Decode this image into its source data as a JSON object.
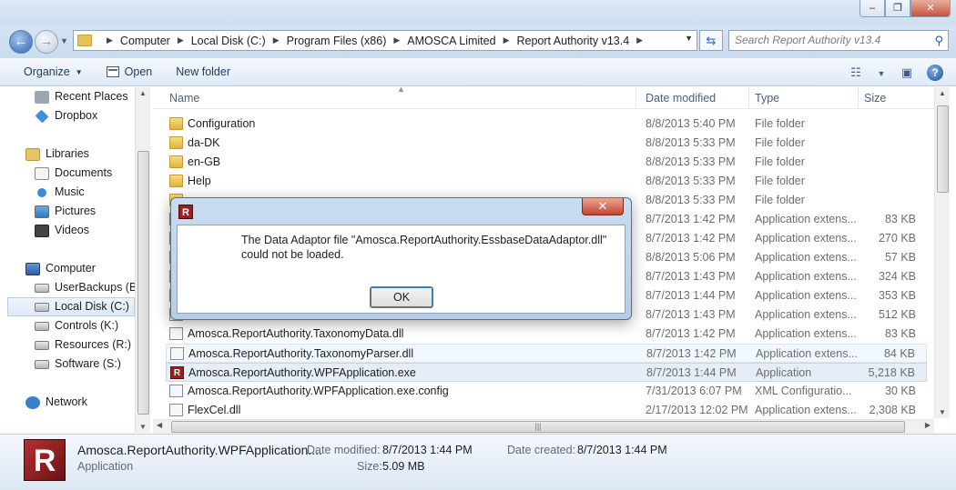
{
  "window": {
    "min": "–",
    "max": "❐",
    "close": "✕"
  },
  "address": {
    "crumbs": [
      "Computer",
      "Local Disk (C:)",
      "Program Files (x86)",
      "AMOSCA Limited",
      "Report Authority v13.4"
    ],
    "sep": "▶"
  },
  "search": {
    "placeholder": "Search Report Authority v13.4"
  },
  "toolbar": {
    "organize": "Organize",
    "open": "Open",
    "new_folder": "New folder"
  },
  "nav": {
    "recent": "Recent Places",
    "dropbox": "Dropbox",
    "libraries": "Libraries",
    "documents": "Documents",
    "music": "Music",
    "pictures": "Pictures",
    "videos": "Videos",
    "computer": "Computer",
    "drive_b": "UserBackups (B:)",
    "drive_c": "Local Disk (C:)",
    "drive_k": "Controls (K:)",
    "drive_r": "Resources (R:)",
    "drive_s": "Software (S:)",
    "network": "Network"
  },
  "columns": {
    "name": "Name",
    "date": "Date modified",
    "type": "Type",
    "size": "Size"
  },
  "files": [
    {
      "name": "Configuration",
      "date": "8/8/2013 5:40 PM",
      "type": "File folder",
      "size": "",
      "icon": "folder"
    },
    {
      "name": "da-DK",
      "date": "8/8/2013 5:33 PM",
      "type": "File folder",
      "size": "",
      "icon": "folder"
    },
    {
      "name": "en-GB",
      "date": "8/8/2013 5:33 PM",
      "type": "File folder",
      "size": "",
      "icon": "folder"
    },
    {
      "name": "Help",
      "date": "8/8/2013 5:33 PM",
      "type": "File folder",
      "size": "",
      "icon": "folder"
    },
    {
      "name": "",
      "date": "8/8/2013 5:33 PM",
      "type": "File folder",
      "size": "",
      "icon": "folder"
    },
    {
      "name": "",
      "date": "8/7/2013 1:42 PM",
      "type": "Application extens...",
      "size": "83 KB",
      "icon": "dll"
    },
    {
      "name": "",
      "date": "8/7/2013 1:42 PM",
      "type": "Application extens...",
      "size": "270 KB",
      "icon": "dll"
    },
    {
      "name": "",
      "date": "8/8/2013 5:06 PM",
      "type": "Application extens...",
      "size": "57 KB",
      "icon": "dll"
    },
    {
      "name": "",
      "date": "8/7/2013 1:43 PM",
      "type": "Application extens...",
      "size": "324 KB",
      "icon": "dll"
    },
    {
      "name": "",
      "date": "8/7/2013 1:44 PM",
      "type": "Application extens...",
      "size": "353 KB",
      "icon": "dll"
    },
    {
      "name": "",
      "date": "8/7/2013 1:43 PM",
      "type": "Application extens...",
      "size": "512 KB",
      "icon": "dll"
    },
    {
      "name": "Amosca.ReportAuthority.TaxonomyData.dll",
      "date": "8/7/2013 1:42 PM",
      "type": "Application extens...",
      "size": "83 KB",
      "icon": "dll"
    },
    {
      "name": "Amosca.ReportAuthority.TaxonomyParser.dll",
      "date": "8/7/2013 1:42 PM",
      "type": "Application extens...",
      "size": "84 KB",
      "icon": "dll"
    },
    {
      "name": "Amosca.ReportAuthority.WPFApplication.exe",
      "date": "8/7/2013 1:44 PM",
      "type": "Application",
      "size": "5,218 KB",
      "icon": "exe"
    },
    {
      "name": "Amosca.ReportAuthority.WPFApplication.exe.config",
      "date": "7/31/2013 6:07 PM",
      "type": "XML Configuratio...",
      "size": "30 KB",
      "icon": "config"
    },
    {
      "name": "FlexCel.dll",
      "date": "2/17/2013 12:02 PM",
      "type": "Application extens...",
      "size": "2,308 KB",
      "icon": "dll"
    }
  ],
  "details": {
    "name": "Amosca.ReportAuthority.WPFApplication....",
    "type": "Application",
    "modified_label": "Date modified:",
    "modified_value": "8/7/2013 1:44 PM",
    "created_label": "Date created:",
    "created_value": "8/7/2013 1:44 PM",
    "size_label": "Size:",
    "size_value": "5.09 MB",
    "icon_letter": "R"
  },
  "dialog": {
    "icon_letter": "R",
    "close": "✕",
    "message": "The Data Adaptor file \"Amosca.ReportAuthority.EssbaseDataAdaptor.dll\" could not be loaded.",
    "ok": "OK"
  }
}
